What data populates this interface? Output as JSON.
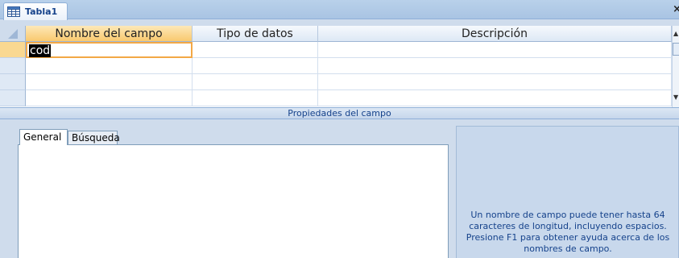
{
  "document_tab": {
    "title": "Tabla1",
    "close_glyph": "×"
  },
  "grid": {
    "columns": [
      {
        "label": "Nombre del campo"
      },
      {
        "label": "Tipo de datos"
      },
      {
        "label": "Descripción"
      }
    ],
    "rows": [
      {
        "field_name": "cod",
        "data_type": "",
        "description": ""
      },
      {
        "field_name": "",
        "data_type": "",
        "description": ""
      },
      {
        "field_name": "",
        "data_type": "",
        "description": ""
      },
      {
        "field_name": "",
        "data_type": "",
        "description": ""
      }
    ]
  },
  "properties": {
    "header": "Propiedades del campo",
    "tabs": [
      {
        "label": "General"
      },
      {
        "label": "Búsqueda"
      }
    ],
    "help_text": "Un nombre de campo puede tener hasta 64 caracteres de longitud, incluyendo espacios. Presione F1 para obtener ayuda acerca de los nombres de campo."
  },
  "colors": {
    "accent": "#f3a846",
    "header_text": "#15428b"
  },
  "icons": [
    "table-icon",
    "close-icon",
    "scroll-up-icon",
    "scroll-down-icon"
  ]
}
